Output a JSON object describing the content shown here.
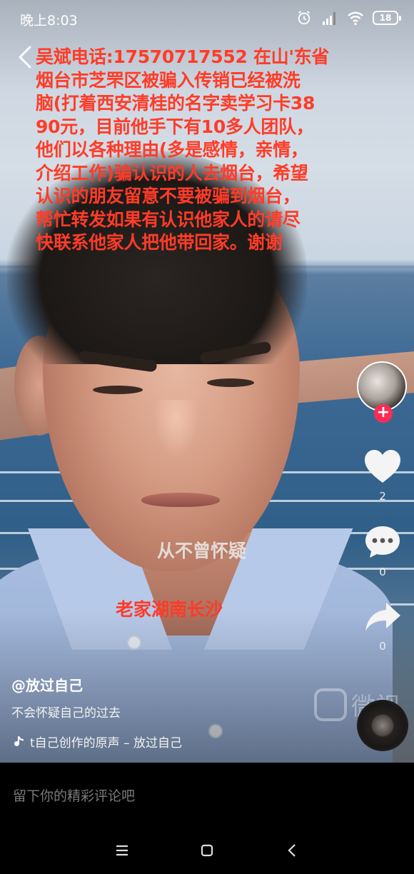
{
  "status_bar": {
    "time": "晚上8:03",
    "battery": "18",
    "icons": [
      "alarm-icon",
      "signal-icon",
      "wifi-icon",
      "battery-icon"
    ]
  },
  "video": {
    "overlay_lines": [
      "吴斌电话:17570717552 在山'东省",
      "烟台市芝罘区被骗入传销已经被洗",
      "脑(打着西安清桂的名字卖学习卡38",
      "90元，目前他手下有10多人团队，",
      "他们以各种理由(多是感情，亲情，",
      "介绍工作)骗认识的人去烟台，希望",
      "认识的朋友留意不要被骗到烟台，",
      "帮忙转发如果有认识他家人的请尽",
      "快联系他家人把他带回家。谢谢"
    ],
    "lyric": "从不曾怀疑",
    "hometown": "老家湖南长沙",
    "watermark": "微视"
  },
  "actions": {
    "follow": "+",
    "like_count": "2",
    "comment_count": "0",
    "share_count": "0"
  },
  "info": {
    "author": "@放过自己",
    "caption": "不会怀疑自己的过去",
    "music": "t自己创作的原声 – 放过自己"
  },
  "comment": {
    "placeholder": "留下你的精彩评论吧"
  },
  "colors": {
    "overlay_red": "#ff3c28",
    "follow_pink": "#fe2c55"
  }
}
